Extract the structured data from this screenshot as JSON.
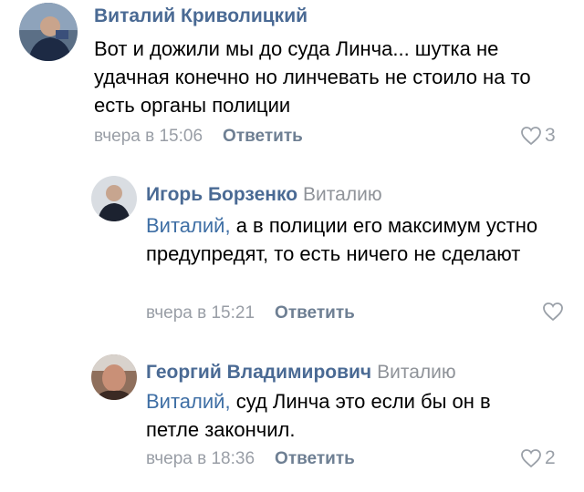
{
  "comments": [
    {
      "author": "Виталий Криволицкий",
      "text": "Вот и дожили мы до суда Линча... шутка не удачная конечно но линчевать не стоило на то есть органы полиции",
      "time": "вчера в 15:06",
      "reply_label": "Ответить",
      "likes": "3",
      "avatar_icon": "user-photo-avatar"
    },
    {
      "author": "Игорь Борзенко",
      "reply_to": "Виталию",
      "mention": "Виталий,",
      "text": "а в полиции его максимум устно предупредят, то есть ничего не сделают",
      "time": "вчера в 15:21",
      "reply_label": "Ответить",
      "likes": "",
      "avatar_icon": "user-photo-avatar"
    },
    {
      "author": "Георгий Владимирович",
      "reply_to": "Виталию",
      "mention": "Виталий,",
      "text": "суд Линча это если бы он в петле закончил.",
      "time": "вчера в 18:36",
      "reply_label": "Ответить",
      "likes": "2",
      "avatar_icon": "user-photo-avatar"
    }
  ],
  "colors": {
    "author": "#4a6a94",
    "mention": "#3f6fa5",
    "meta": "#999ea6",
    "reply_button": "#6e7f93",
    "like_icon": "#9aa0a8"
  }
}
